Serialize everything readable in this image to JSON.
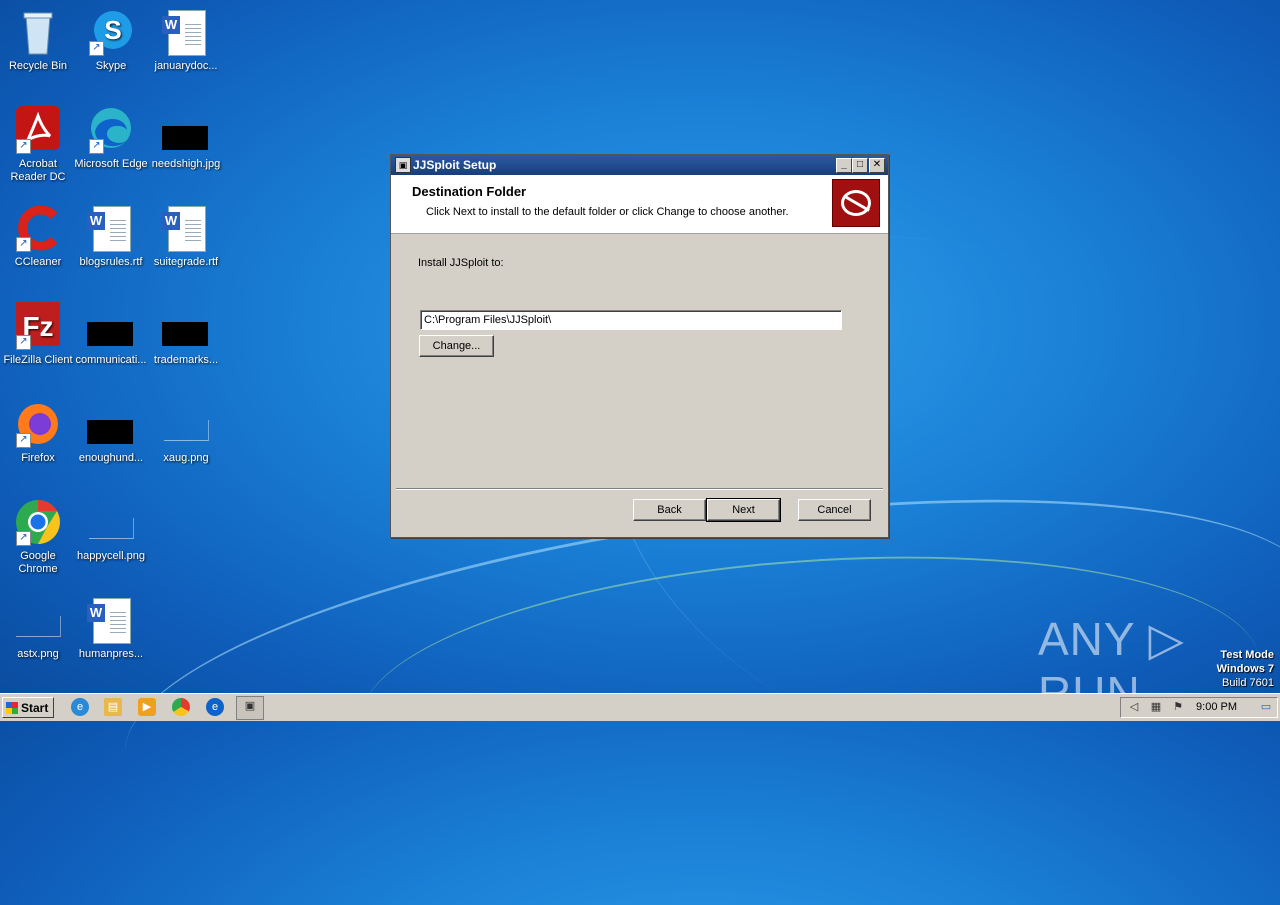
{
  "desktop": {
    "icons": [
      {
        "label": "Recycle Bin"
      },
      {
        "label": "Skype"
      },
      {
        "label": "januarydoc..."
      },
      {
        "label": "Acrobat Reader DC"
      },
      {
        "label": "Microsoft Edge"
      },
      {
        "label": "needshigh.jpg"
      },
      {
        "label": "CCleaner"
      },
      {
        "label": "blogsrules.rtf"
      },
      {
        "label": "suitegrade.rtf"
      },
      {
        "label": "FileZilla Client"
      },
      {
        "label": "communicati..."
      },
      {
        "label": "trademarks..."
      },
      {
        "label": "Firefox"
      },
      {
        "label": "enoughund..."
      },
      {
        "label": "xaug.png"
      },
      {
        "label": "Google Chrome"
      },
      {
        "label": "happycell.png"
      },
      {
        "label": "astx.png"
      },
      {
        "label": "humanpres..."
      }
    ]
  },
  "dialog": {
    "title": "JJSploit Setup",
    "header_title": "Destination Folder",
    "header_subtitle": "Click Next to install to the default folder or click Change to choose another.",
    "install_label": "Install JJSploit to:",
    "path_value": "C:\\Program Files\\JJSploit\\",
    "change_label": "Change...",
    "back_label": "Back",
    "next_label": "Next",
    "cancel_label": "Cancel",
    "minimize_glyph": "_",
    "maximize_glyph": "□",
    "close_glyph": "✕"
  },
  "watermark": {
    "text": "ANY ▷ RUN"
  },
  "os_info": {
    "line1": "Test Mode",
    "line2": "Windows 7",
    "line3": "Build 7601"
  },
  "taskbar": {
    "start_label": "Start",
    "clock": "9:00 PM",
    "quick_launch": [
      "ie-icon",
      "explorer-icon",
      "media-player-icon",
      "chrome-icon",
      "edge-icon",
      "jjsploit-setup-icon"
    ],
    "tray_icons": [
      "volume-icon",
      "network-icon",
      "flag-icon",
      "show-desktop-icon"
    ]
  },
  "colors": {
    "titlebar": "#1f4a8c",
    "dialog_bg": "#d4d0c8",
    "desktop": "#1a7fd6",
    "logo_red": "#a01010"
  }
}
